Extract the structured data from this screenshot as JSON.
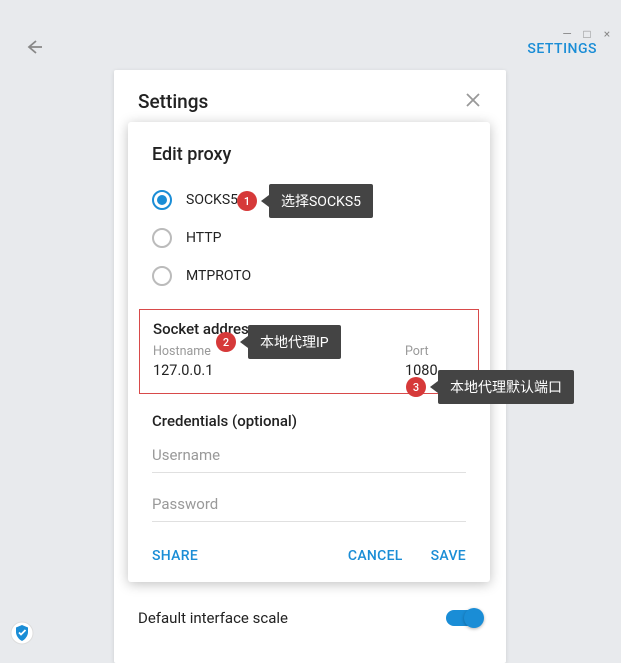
{
  "window": {
    "minimize": "—",
    "maximize": "□",
    "close": "×"
  },
  "topbar": {
    "settings_link": "SETTINGS"
  },
  "settings_panel": {
    "title": "Settings",
    "interface_scale_label": "Default interface scale"
  },
  "dialog": {
    "title": "Edit proxy",
    "radios": {
      "socks5": "SOCKS5",
      "http": "HTTP",
      "mtproto": "MTPROTO"
    },
    "socket_section": {
      "title": "Socket address",
      "hostname_label": "Hostname",
      "hostname_value": "127.0.0.1",
      "port_label": "Port",
      "port_value": "1080"
    },
    "credentials": {
      "title": "Credentials (optional)",
      "username_placeholder": "Username",
      "password_placeholder": "Password"
    },
    "actions": {
      "share": "SHARE",
      "cancel": "CANCEL",
      "save": "SAVE"
    }
  },
  "callouts": {
    "c1": {
      "num": "1",
      "text": "选择SOCKS5"
    },
    "c2": {
      "num": "2",
      "text": "本地代理IP"
    },
    "c3": {
      "num": "3",
      "text": "本地代理默认端口"
    }
  }
}
